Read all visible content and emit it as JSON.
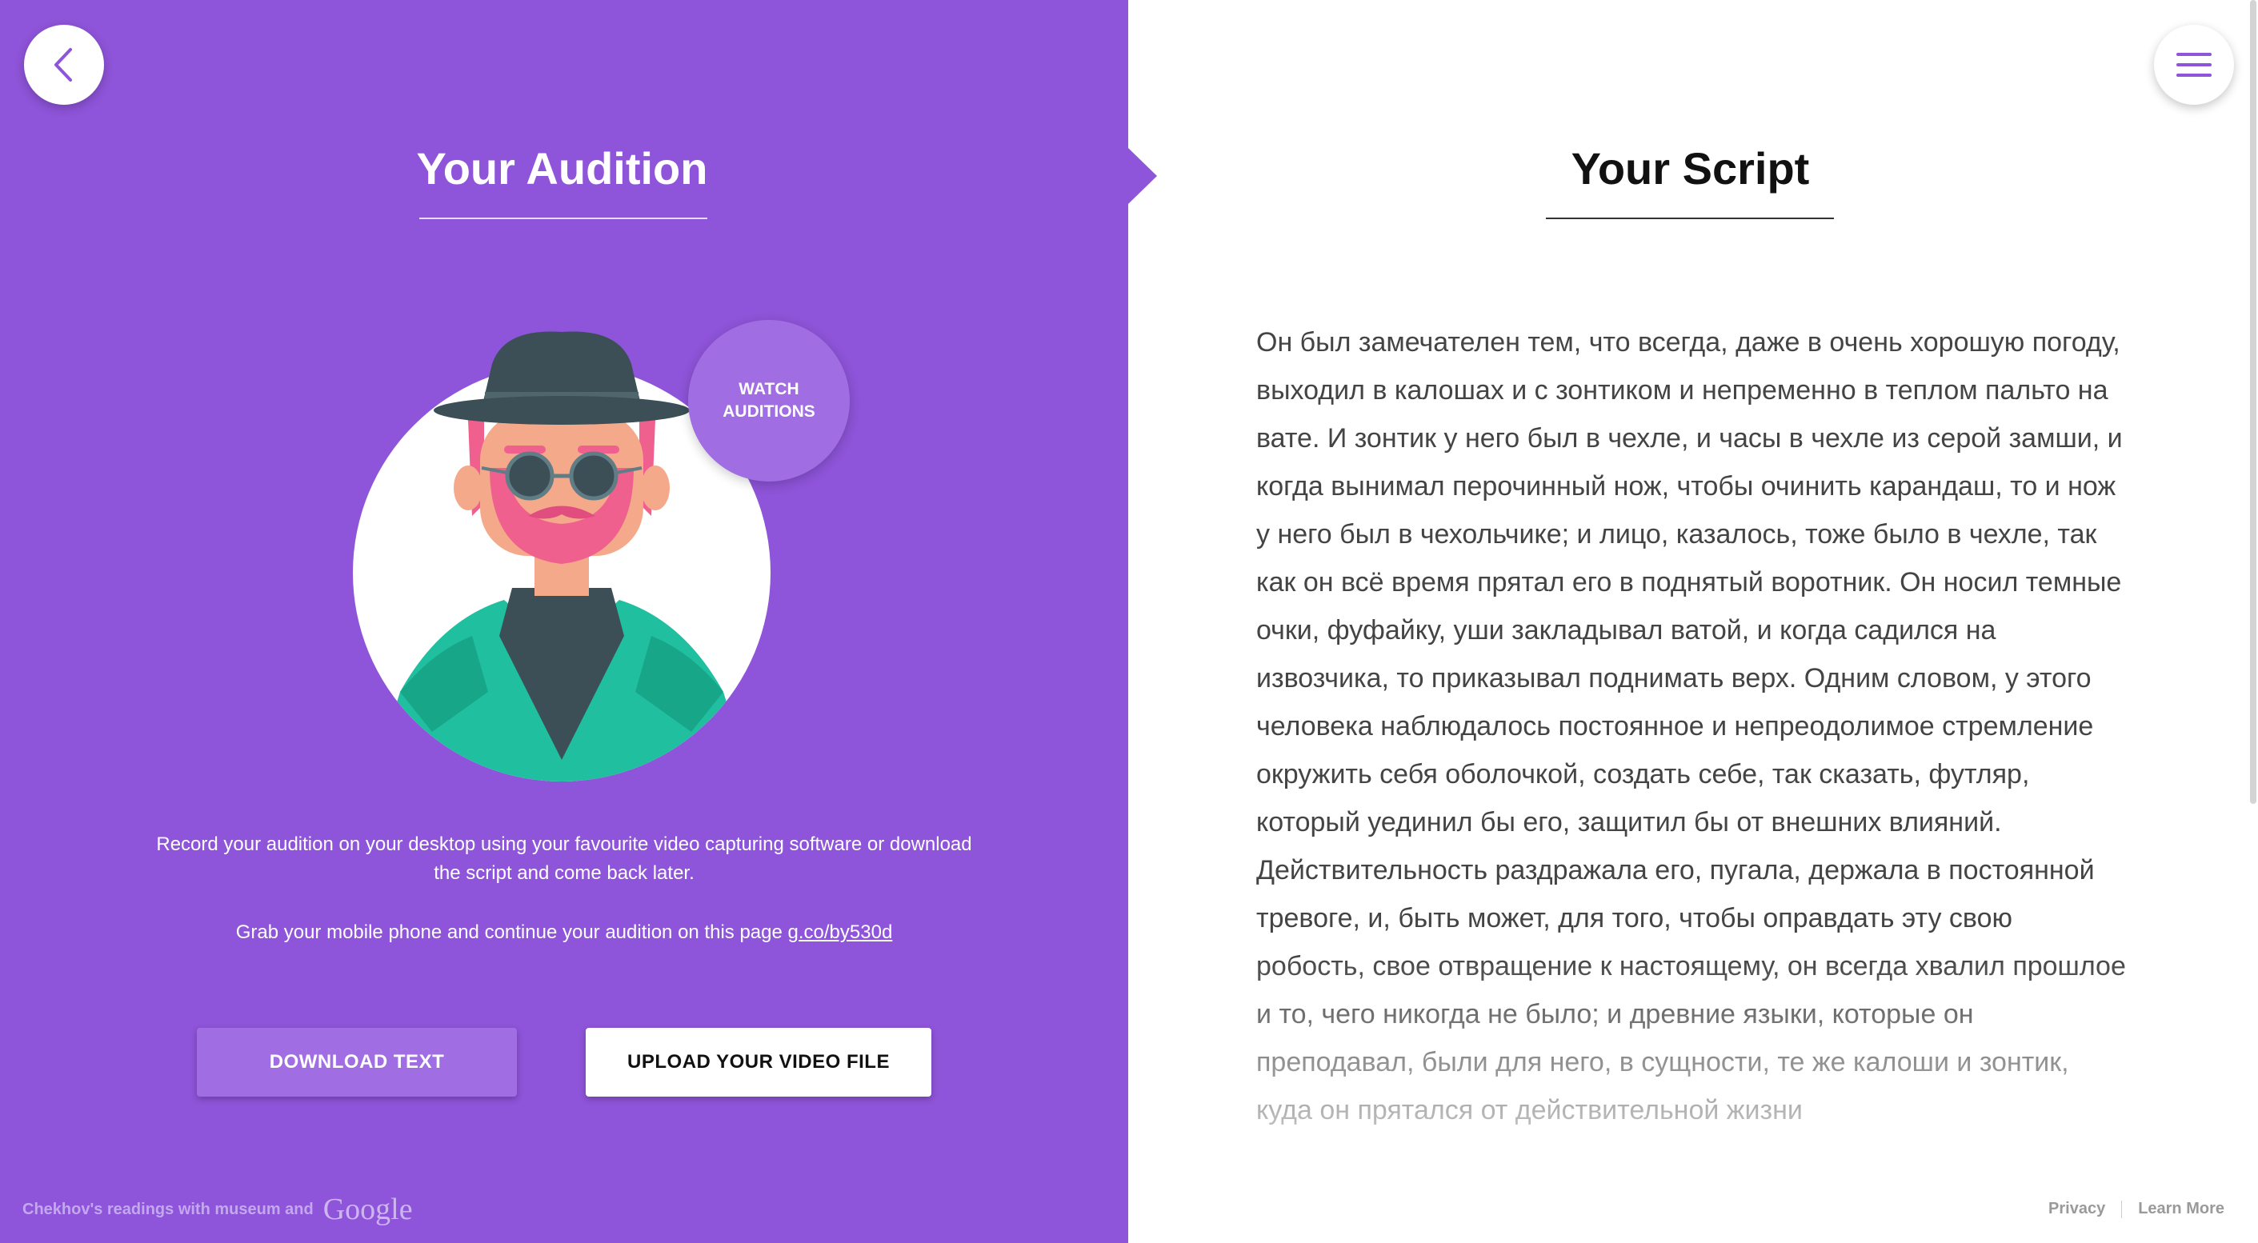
{
  "left_panel": {
    "title": "Your Audition",
    "watch_badge": {
      "line1": "WATCH",
      "line2": "AUDITIONS"
    },
    "description": "Record your audition on your desktop using your favourite video capturing software or download the script and come back later.",
    "mobile_text": "Grab your mobile phone and continue your audition on this page",
    "mobile_link": "g.co/by530d",
    "buttons": {
      "download": "DOWNLOAD TEXT",
      "upload": "UPLOAD YOUR VIDEO FILE"
    },
    "footer": {
      "text": "Chekhov's readings with museum and",
      "brand": "Google"
    }
  },
  "right_panel": {
    "title": "Your Script",
    "script_text": "Он был замечателен тем, что всегда, даже в очень хорошую погоду, выходил в калошах и с зонтиком и непременно в теплом пальто на вате. И зонтик у него был в чехле, и часы в чехле из серой замши, и когда вынимал перочинный нож, чтобы очинить карандаш, то и нож у него был в чехольчике; и лицо, казалось, тоже было в чехле, так как он всё время прятал его в поднятый воротник. Он носил темные очки, фуфайку, уши закладывал ватой, и когда садился на извозчика, то приказывал поднимать верх. Одним словом, у этого человека наблюдалось постоянное и непреодолимое стремление окружить себя оболочкой, создать себе, так сказать, футляр, который уединил бы его, защитил бы от внешних влияний. Действительность раздражала его, пугала, держала в постоянной тревоге, и, быть может, для того, чтобы оправдать эту свою робость, свое отвращение к настоящему, он всегда хвалил прошлое и то, чего никогда не было; и древние языки, которые он преподавал, были для него, в сущности, те же калоши и зонтик, куда он прятался от действительной жизни",
    "footer": {
      "privacy": "Privacy",
      "learn_more": "Learn More"
    }
  },
  "icons": {
    "back": "chevron-left-icon",
    "menu": "hamburger-menu-icon"
  },
  "colors": {
    "accent": "#8e54d9",
    "accent_light": "#a06de2",
    "teal": "#1fbf9f",
    "pink": "#f0608f"
  }
}
